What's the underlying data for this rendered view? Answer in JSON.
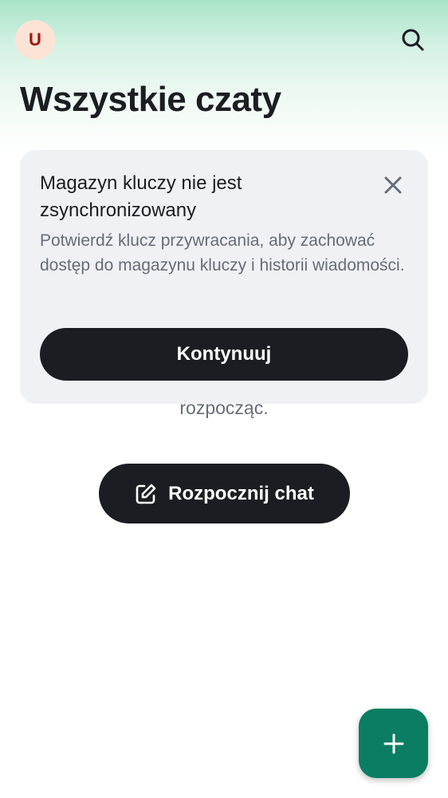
{
  "header": {
    "avatar_initial": "U",
    "title": "Wszystkie czaty"
  },
  "banner": {
    "title": "Magazyn kluczy nie jest zsynchronizowany",
    "description": "Potwierdź klucz przywracania, aby zachować dostęp do magazynu kluczy i historii wiadomości.",
    "button_label": "Kontynuuj"
  },
  "empty_state": {
    "text": "rozpocząć.",
    "button_label": "Rozpocznij chat"
  },
  "icons": {
    "search": "search-icon",
    "close": "close-icon",
    "compose": "compose-icon",
    "add": "plus-icon"
  },
  "colors": {
    "accent": "#0b7d63",
    "dark_button": "#1b1d22",
    "banner_bg": "#f0f1f4",
    "avatar_bg": "#fde3d6",
    "avatar_fg": "#a3160c"
  }
}
